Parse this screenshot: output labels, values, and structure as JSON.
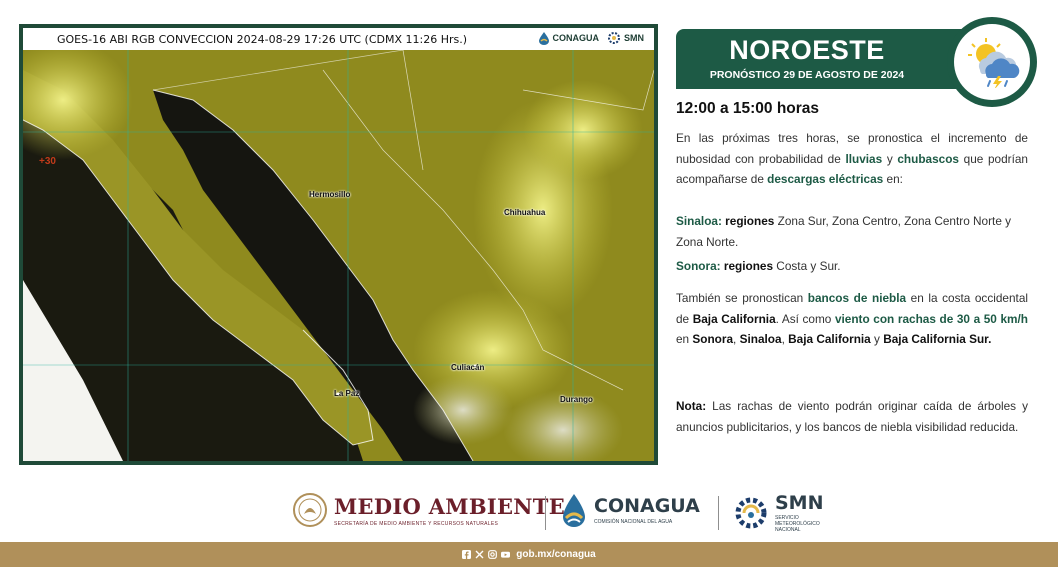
{
  "satellite": {
    "title": "GOES-16 ABI RGB CONVECCION 2024-08-29 17:26 UTC (CDMX  11:26 Hrs.)",
    "logo_conagua": "CONAGUA",
    "logo_smn": "SMN",
    "latitude_label": "+30",
    "cities": [
      "Hermosillo",
      "Chihuahua",
      "Culiacán",
      "La Paz",
      "Durango"
    ]
  },
  "banner": {
    "region": "NOROESTE",
    "subtitle": "PRONÓSTICO 29 DE AGOSTO DE 2024",
    "icon": "sun-cloud-rain-lightning-icon"
  },
  "forecast": {
    "time_range": "12:00 a 15:00 horas",
    "intro": {
      "t1": "En las próximas tres horas, se pronostica el incremento de nubosidad con probabilidad de ",
      "k1": "lluvias",
      "t2": " y ",
      "k2": "chubascos",
      "t3": " que podrían acompañarse de ",
      "k3": "descargas eléctricas",
      "t4": " en:"
    },
    "sinaloa": {
      "state": "Sinaloa:",
      "label": "regiones",
      "regions": " Zona Sur, Zona Centro, Zona Centro Norte y Zona Norte."
    },
    "sonora": {
      "state": "Sonora:",
      "label": "regiones",
      "regions": " Costa y Sur."
    },
    "fog": {
      "t1": "También se pronostican ",
      "k1": "bancos de niebla",
      "t2": " en la costa occidental de ",
      "b1": "Baja California",
      "t3": ". Así como ",
      "k2": "viento con rachas de 30 a 50 km/h",
      "t4": " en ",
      "b2": "Sonora",
      "t5": ", ",
      "b3": "Sinaloa",
      "t6": ", ",
      "b4": "Baja California",
      "t7": " y ",
      "b5": "Baja California Sur."
    },
    "note": {
      "label": "Nota:",
      "text": " Las rachas de viento podrán originar caída de árboles y anuncios publicitarios, y los bancos de niebla visibilidad reducida."
    }
  },
  "logos": {
    "medio_ambiente": "MEDIO AMBIENTE",
    "medio_ambiente_sub": "SECRETARÍA DE MEDIO AMBIENTE Y RECURSOS NATURALES",
    "conagua": "CONAGUA",
    "conagua_sub": "COMISIÓN NACIONAL DEL AGUA",
    "smn": "SMN",
    "smn_sub1": "SERVICIO",
    "smn_sub2": "METEOROLÓGICO",
    "smn_sub3": "NACIONAL"
  },
  "footer": {
    "url": "gob.mx/conagua",
    "social": [
      "facebook-icon",
      "x-icon",
      "instagram-icon",
      "youtube-icon"
    ]
  },
  "colors": {
    "brand_green": "#1d5a45",
    "footer_gold": "#b0905a",
    "guinda": "#6b1f2a"
  }
}
